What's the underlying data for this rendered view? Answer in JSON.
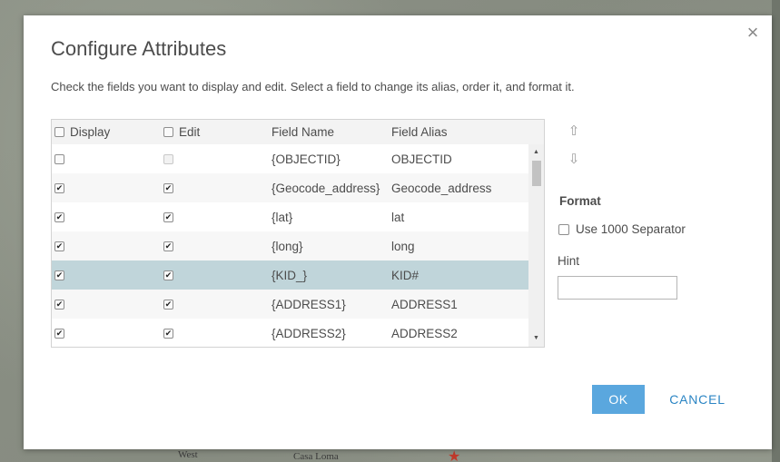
{
  "dialog": {
    "title": "Configure Attributes",
    "instructions": "Check the fields you want to display and edit. Select a field to change its alias, order it, and format it.",
    "close_symbol": "×"
  },
  "grid": {
    "headers": {
      "display": "Display",
      "edit": "Edit",
      "field_name": "Field Name",
      "field_alias": "Field Alias"
    },
    "rows": [
      {
        "display": false,
        "edit": false,
        "edit_disabled": true,
        "field_name": "{OBJECTID}",
        "field_alias": "OBJECTID",
        "selected": false
      },
      {
        "display": true,
        "edit": true,
        "edit_disabled": false,
        "field_name": "{Geocode_address}",
        "field_alias": "Geocode_address",
        "selected": false
      },
      {
        "display": true,
        "edit": true,
        "edit_disabled": false,
        "field_name": "{lat}",
        "field_alias": "lat",
        "selected": false
      },
      {
        "display": true,
        "edit": true,
        "edit_disabled": false,
        "field_name": "{long}",
        "field_alias": "long",
        "selected": false
      },
      {
        "display": true,
        "edit": true,
        "edit_disabled": false,
        "field_name": "{KID_}",
        "field_alias": "KID#",
        "selected": true
      },
      {
        "display": true,
        "edit": true,
        "edit_disabled": false,
        "field_name": "{ADDRESS1}",
        "field_alias": "ADDRESS1",
        "selected": false
      },
      {
        "display": true,
        "edit": true,
        "edit_disabled": false,
        "field_name": "{ADDRESS2}",
        "field_alias": "ADDRESS2",
        "selected": false
      }
    ]
  },
  "side": {
    "move_up_icon": "arrow-up-icon",
    "move_down_icon": "arrow-down-icon",
    "format_title": "Format",
    "separator_label": "Use 1000 Separator",
    "separator_checked": false,
    "hint_label": "Hint",
    "hint_value": ""
  },
  "footer": {
    "ok_label": "OK",
    "cancel_label": "CANCEL"
  },
  "map": {
    "labels": [
      "West",
      "Casa Loma"
    ]
  },
  "colors": {
    "accent": "#5aa7de",
    "link": "#2b85c4",
    "selected_row": "#c0d5da"
  }
}
